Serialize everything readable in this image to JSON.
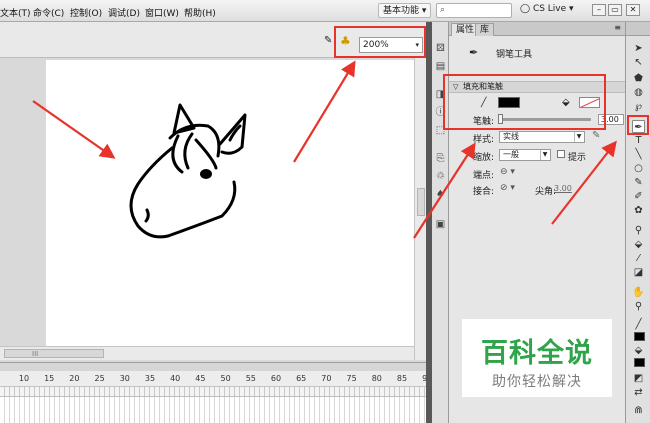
{
  "menu": {
    "items": [
      "文本(T)",
      "命令(C)",
      "控制(O)",
      "调试(D)",
      "窗口(W)",
      "帮助(H)"
    ],
    "workspace": "基本功能",
    "workspace_arrow": "▾",
    "cs_live": "CS Live",
    "window_buttons": [
      "–",
      "▭",
      "✕"
    ]
  },
  "editbar": {
    "zoom": "200%",
    "zoom_arrow": "▾"
  },
  "timeline": {
    "ruler": [
      "10",
      "15",
      "20",
      "25",
      "30",
      "35",
      "40",
      "45",
      "50",
      "55",
      "60",
      "65",
      "70",
      "75",
      "80",
      "85",
      "90"
    ]
  },
  "panel": {
    "tabs": [
      "属性",
      "库"
    ],
    "tab_menu": "≡",
    "tool_name": "钢笔工具",
    "section_fill_stroke": "填充和笔触",
    "section_arrow": "▽",
    "stroke_label": "笔触:",
    "stroke_value": "3.00",
    "style_label": "样式:",
    "style_value": "实线",
    "scale_label": "缩放:",
    "scale_value": "一般",
    "hint_label": "提示",
    "cap_label": "端点:",
    "join_label": "接合:",
    "miter_label": "尖角:",
    "miter_value": "3.00"
  },
  "watermark": {
    "title": "百科全说",
    "subtitle": "助你轻松解决"
  },
  "colors": {
    "highlight": "#e8332b",
    "watermark_green": "#2fa44a",
    "stroke_color": "#000000"
  },
  "icons": {
    "pen_tool_active": "pen-icon",
    "search": "search-icon"
  }
}
